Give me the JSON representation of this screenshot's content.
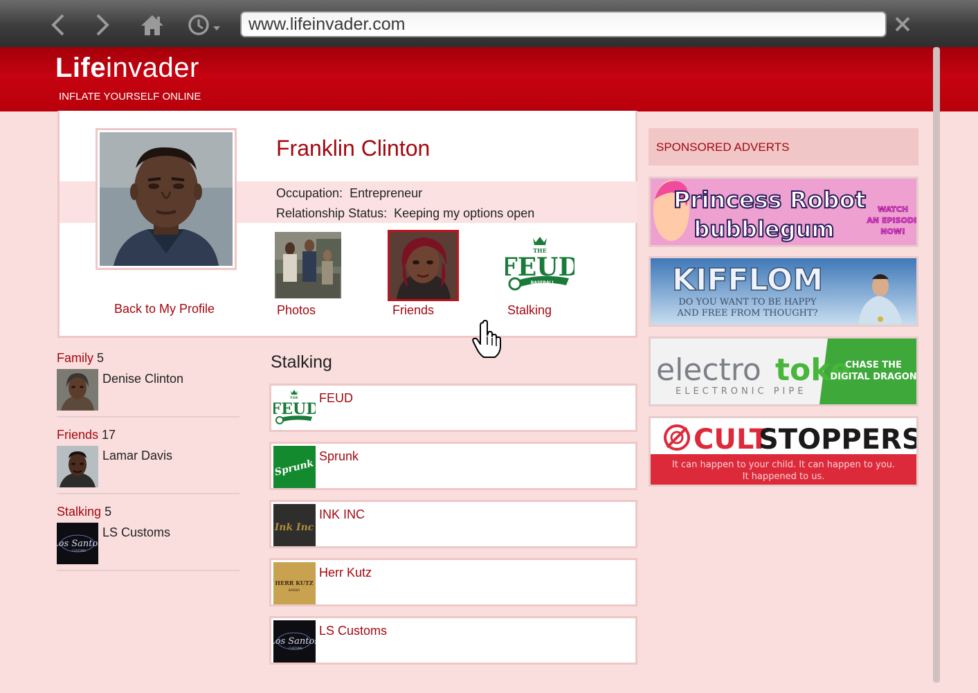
{
  "browser": {
    "url": "www.lifeinvader.com"
  },
  "site": {
    "logo_bold": "Life",
    "logo_light": "invader",
    "tagline": "INFLATE YOURSELF ONLINE"
  },
  "profile": {
    "name": "Franklin Clinton",
    "occupation_label": "Occupation:",
    "occupation_value": "Entrepreneur",
    "relationship_label": "Relationship Status:",
    "relationship_value": "Keeping my options open",
    "back_link": "Back to My Profile",
    "tiles": [
      "Photos",
      "Friends",
      "Stalking"
    ]
  },
  "sidebar": {
    "family": {
      "label": "Family",
      "count": "5",
      "item": "Denise Clinton"
    },
    "friends": {
      "label": "Friends",
      "count": "17",
      "item": "Lamar Davis"
    },
    "stalking": {
      "label": "Stalking",
      "count": "5",
      "item": "LS Customs"
    }
  },
  "stalking": {
    "title": "Stalking",
    "items": [
      "FEUD",
      "Sprunk",
      "INK INC",
      "Herr Kutz",
      "LS Customs"
    ]
  },
  "ads": {
    "header": "SPONSORED ADVERTS",
    "princess": {
      "title": "Princess Robot",
      "subtitle": "bubblegum",
      "cta1": "WATCH",
      "cta2": "AN EPISODE",
      "cta3": "NOW!"
    },
    "kifflom": {
      "title": "KIFFLOM",
      "line1": "DO YOU WANT TO BE HAPPY",
      "line2": "AND FREE FROM THOUGHT?"
    },
    "electrotoke": {
      "title_a": "electro",
      "title_b": "toke",
      "sub": "ELECTRONIC PIPE",
      "cta1": "CHASE THE",
      "cta2": "DIGITAL DRAGON"
    },
    "cultstoppers": {
      "title_a": "CULT",
      "title_b": "STOPPERS",
      "line1": "It can happen to your child.  It can happen to you.",
      "line2": "It happened to us."
    }
  },
  "logos": {
    "feud_the": "THE",
    "feud_main": "FEUD",
    "feud_sub": "BASEBALL",
    "sprunk": "Sprunk",
    "inkinc": "Ink Inc",
    "herrkutz": "HERR KUTZ",
    "herrkutz_sub": "BARBER",
    "lsc": "Los Santos",
    "lsc_sub": "CUSTOMS"
  },
  "colors": {
    "brand_red": "#c60310",
    "link_red": "#a3080f",
    "page_bg": "#f9dedd"
  },
  "icons": {
    "back": "chevron-left-icon",
    "forward": "chevron-right-icon",
    "home": "home-icon",
    "history": "clock-icon",
    "close": "close-icon",
    "cursor": "hand-pointer-icon"
  }
}
